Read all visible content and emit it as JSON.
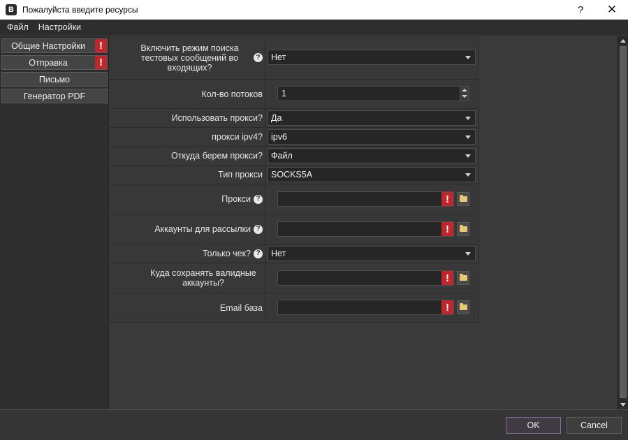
{
  "window": {
    "title": "Пожалуйста введите ресурсы",
    "app_icon": "B",
    "help": "?",
    "close": "✕"
  },
  "menu": [
    {
      "label": "Файл"
    },
    {
      "label": "Настройки"
    }
  ],
  "tabs": [
    {
      "label": "Общие Настройки",
      "warning": "!"
    },
    {
      "label": "Отправка",
      "warning": "!"
    },
    {
      "label": "Письмо"
    },
    {
      "label": "Генератор PDF"
    }
  ],
  "fields": {
    "test_mode": {
      "label": "Включить режим поиска тестовых сообщений во входящих?",
      "value": "Нет"
    },
    "threads": {
      "label": "Кол-во потоков",
      "value": "1"
    },
    "use_proxy": {
      "label": "Использовать прокси?",
      "value": "Да"
    },
    "proxy_ipv4": {
      "label": "прокси ipv4?",
      "value": "ipv6"
    },
    "proxy_source": {
      "label": "Откуда берем прокси?",
      "value": "Файл"
    },
    "proxy_type": {
      "label": "Тип прокси",
      "value": "SOCKS5A"
    },
    "proxies": {
      "label": "Прокси",
      "value": "",
      "warning": "!"
    },
    "accounts": {
      "label": "Аккаунты для рассылки",
      "value": "",
      "warning": "!"
    },
    "check_only": {
      "label": "Только чек?",
      "value": "Нет"
    },
    "valid_path": {
      "label": "Куда сохранять валидные аккаунты?",
      "value": "",
      "warning": "!"
    },
    "email_base": {
      "label": "Email база",
      "value": "",
      "warning": "!"
    }
  },
  "help_glyph": "?",
  "buttons": {
    "ok": "OK",
    "cancel": "Cancel"
  },
  "colors": {
    "warning": "#c0272d",
    "ok_border": "#8b6fa3",
    "folder": "#e8c873"
  }
}
